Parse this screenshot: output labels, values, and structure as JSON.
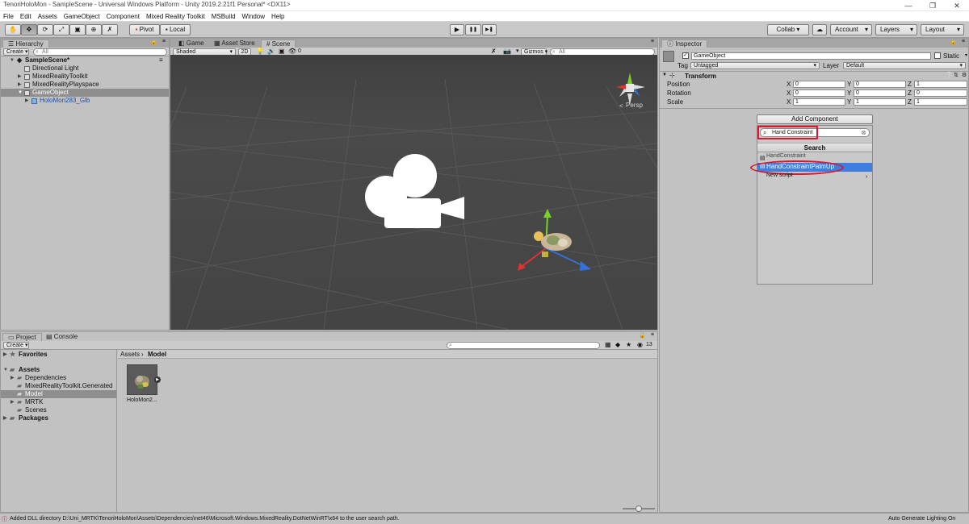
{
  "window": {
    "title": "TenoriHoloMon - SampleScene - Universal Windows Platform - Unity 2019.2.21f1 Personal* <DX11>",
    "minimize": "—",
    "maximize": "❐",
    "close": "✕"
  },
  "menu": [
    "File",
    "Edit",
    "Assets",
    "GameObject",
    "Component",
    "Mixed Reality Toolkit",
    "MSBuild",
    "Window",
    "Help"
  ],
  "toolbar": {
    "pivot": "Pivot",
    "local": "Local",
    "play": "▶",
    "pause": "❚❚",
    "step": "▶❚",
    "collab": "Collab ▾",
    "account": "Account",
    "layers": "Layers",
    "layout": "Layout"
  },
  "hierarchy": {
    "tab": "Hierarchy",
    "create": "Create ▾",
    "search_placeholder": "All",
    "scene": "SampleScene*",
    "items": [
      "Directional Light",
      "MixedRealityToolkit",
      "MixedRealityPlayspace",
      "GameObject",
      "HoloMon283_Glb"
    ]
  },
  "sceneview": {
    "tabs": [
      "Game",
      "Asset Store",
      "Scene"
    ],
    "shading": "Shaded",
    "mode2d": "2D",
    "fx_count": "0",
    "gizmos": "Gizmos ▾",
    "search_placeholder": "All",
    "persp": "Persp"
  },
  "inspector": {
    "tab": "Inspector",
    "object_name": "GameObject",
    "static_label": "Static",
    "tag_label": "Tag",
    "tag_value": "Untagged",
    "layer_label": "Layer",
    "layer_value": "Default",
    "transform_title": "Transform",
    "position_label": "Position",
    "rotation_label": "Rotation",
    "scale_label": "Scale",
    "axis_x": "X",
    "axis_y": "Y",
    "axis_z": "Z",
    "position": [
      "0",
      "0",
      "1"
    ],
    "rotation": [
      "0",
      "0",
      "0"
    ],
    "scale": [
      "1",
      "1",
      "1"
    ]
  },
  "add_component": {
    "button": "Add Component",
    "search_value": "Hand Constraint",
    "search_header": "Search",
    "results": [
      "HandConstraint",
      "HandConstraintPalmUp",
      "New script"
    ],
    "highlight_color": "#e0142a",
    "selected_color": "#3d7ee0"
  },
  "project": {
    "tabs": [
      "Project",
      "Console"
    ],
    "create": "Create ▾",
    "favorites": "Favorites",
    "assets": "Assets",
    "folders": [
      "Dependencies",
      "MixedRealityToolkit.Generated",
      "Model",
      "MRTK",
      "Scenes"
    ],
    "packages": "Packages",
    "breadcrumb": [
      "Assets",
      "Model"
    ],
    "asset_count": "13",
    "asset_name": "HoloMon2..."
  },
  "status": {
    "message": "Added DLL directory D:\\Uni_MRTK\\TenoriHoloMon\\Assets\\Dependencies\\net46\\Microsoft.Windows.MixedReality.DotNetWinRT\\x64 to the user search path.",
    "right": "Auto Generate Lighting On"
  }
}
